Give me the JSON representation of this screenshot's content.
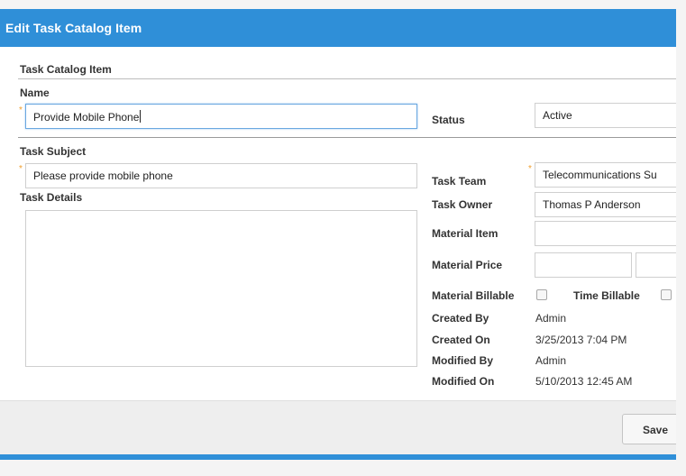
{
  "dialog": {
    "title": "Edit Task Catalog Item"
  },
  "section": {
    "title": "Task Catalog Item"
  },
  "fields": {
    "name_label": "Name",
    "name_value": "Provide Mobile Phone",
    "status_label": "Status",
    "status_value": "Active",
    "task_subject_label": "Task Subject",
    "task_subject_value": "Please provide mobile phone",
    "task_details_label": "Task Details",
    "task_team_label": "Task Team",
    "task_team_value": "Telecommunications Su",
    "task_owner_label": "Task Owner",
    "task_owner_value": "Thomas P Anderson",
    "material_item_label": "Material Item",
    "material_price_label": "Material Price",
    "material_billable_label": "Material Billable",
    "time_billable_label": "Time Billable",
    "created_by_label": "Created By",
    "created_by_value": "Admin",
    "created_on_label": "Created On",
    "created_on_value": "3/25/2013 7:04 PM",
    "modified_by_label": "Modified By",
    "modified_by_value": "Admin",
    "modified_on_label": "Modified On",
    "modified_on_value": "5/10/2013 12:45 AM"
  },
  "required_marker": "*",
  "footer": {
    "save_label": "Save"
  },
  "colors": {
    "accent": "#2f8fd8",
    "required": "#f0a030"
  }
}
